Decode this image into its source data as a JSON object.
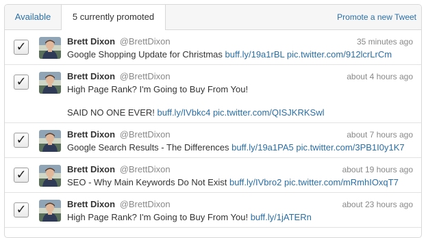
{
  "tabs": {
    "available": "Available",
    "promoted": "5 currently promoted"
  },
  "header": {
    "promote_link": "Promote a new Tweet"
  },
  "colors": {
    "accent": "#2a6ea6",
    "muted": "#888888"
  },
  "tweets": [
    {
      "checked": true,
      "author": "Brett Dixon",
      "handle": "@BrettDixon",
      "time": "35 minutes ago",
      "text": "Google Shopping Update for Christmas",
      "links": [
        "buff.ly/19a1rBL",
        "pic.twitter.com/912lcrLrCm"
      ]
    },
    {
      "checked": true,
      "author": "Brett Dixon",
      "handle": "@BrettDixon",
      "time": "about 4 hours ago",
      "text": "High Page Rank? I'm Going to Buy From You!",
      "text2": "SAID NO ONE EVER!",
      "links": [
        "buff.ly/IVbkc4",
        "pic.twitter.com/QISJKRKSwl"
      ]
    },
    {
      "checked": true,
      "author": "Brett Dixon",
      "handle": "@BrettDixon",
      "time": "about 7 hours ago",
      "text": "Google Search Results - The Differences",
      "links": [
        "buff.ly/19a1PA5",
        "pic.twitter.com/3PB1I0y1K7"
      ]
    },
    {
      "checked": true,
      "author": "Brett Dixon",
      "handle": "@BrettDixon",
      "time": "about 19 hours ago",
      "text": "SEO - Why Main Keywords Do Not Exist",
      "links": [
        "buff.ly/IVbro2",
        "pic.twitter.com/mRmhIOxqT7"
      ]
    },
    {
      "checked": true,
      "author": "Brett Dixon",
      "handle": "@BrettDixon",
      "time": "about 23 hours ago",
      "text": "High Page Rank? I'm Going to Buy From You!",
      "links": [
        "buff.ly/1jATERn"
      ]
    }
  ]
}
